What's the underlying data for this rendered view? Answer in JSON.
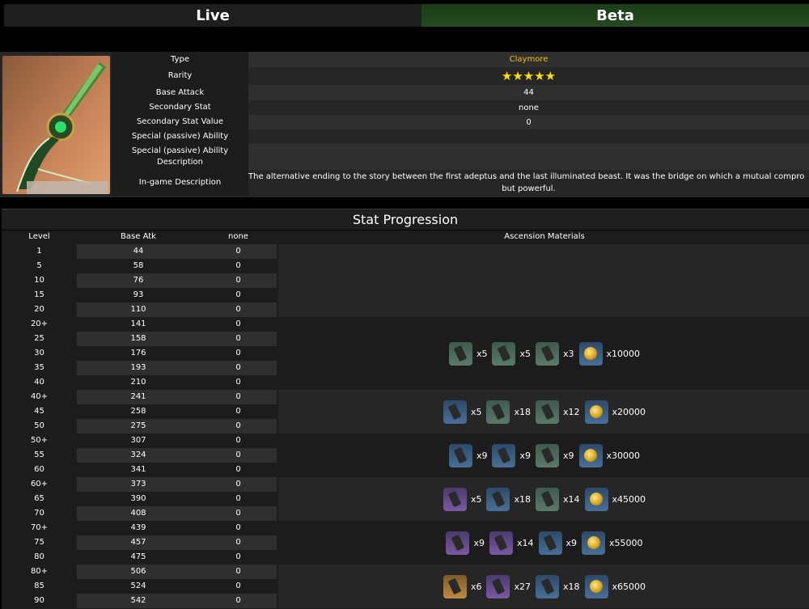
{
  "tabs": {
    "live": "Live",
    "beta": "Beta"
  },
  "info": {
    "type": {
      "label": "Type",
      "value": "Claymore"
    },
    "rarity": {
      "label": "Rarity",
      "stars": "★★★★★"
    },
    "base_attack": {
      "label": "Base Attack",
      "value": "44"
    },
    "secondary_stat": {
      "label": "Secondary Stat",
      "value": "none"
    },
    "secondary_stat_value": {
      "label": "Secondary Stat Value",
      "value": "0"
    },
    "special_ability": {
      "label": "Special (passive) Ability",
      "value": ""
    },
    "special_ability_desc": {
      "label": "Special (passive) Ability Description",
      "value": ""
    },
    "ingame_desc": {
      "label": "In-game Description",
      "line1": "The alternative ending to the story between the first adeptus and the last illuminated beast. It was the bridge on which a mutual compro",
      "line2": "but powerful."
    }
  },
  "stat": {
    "title": "Stat Progression",
    "headers": {
      "level": "Level",
      "base_atk": "Base Atk",
      "secondary": "none",
      "materials": "Ascension Materials"
    },
    "rows": [
      [
        "1",
        "44",
        "0"
      ],
      [
        "5",
        "58",
        "0"
      ],
      [
        "10",
        "76",
        "0"
      ],
      [
        "15",
        "93",
        "0"
      ],
      [
        "20",
        "110",
        "0"
      ],
      [
        "20+",
        "141",
        "0"
      ],
      [
        "25",
        "158",
        "0"
      ],
      [
        "30",
        "176",
        "0"
      ],
      [
        "35",
        "193",
        "0"
      ],
      [
        "40",
        "210",
        "0"
      ],
      [
        "40+",
        "241",
        "0"
      ],
      [
        "45",
        "258",
        "0"
      ],
      [
        "50",
        "275",
        "0"
      ],
      [
        "50+",
        "307",
        "0"
      ],
      [
        "55",
        "324",
        "0"
      ],
      [
        "60",
        "341",
        "0"
      ],
      [
        "60+",
        "373",
        "0"
      ],
      [
        "65",
        "390",
        "0"
      ],
      [
        "70",
        "408",
        "0"
      ],
      [
        "70+",
        "439",
        "0"
      ],
      [
        "75",
        "457",
        "0"
      ],
      [
        "80",
        "475",
        "0"
      ],
      [
        "80+",
        "506",
        "0"
      ],
      [
        "85",
        "524",
        "0"
      ],
      [
        "90",
        "542",
        "0"
      ]
    ],
    "ascensions": [
      {
        "items": [
          {
            "icon": "r2",
            "count": "x5"
          },
          {
            "icon": "r2",
            "count": "x5"
          },
          {
            "icon": "r2",
            "count": "x3"
          },
          {
            "icon": "coin",
            "count": "x10000"
          }
        ]
      },
      {
        "items": [
          {
            "icon": "r3",
            "count": "x5"
          },
          {
            "icon": "r2",
            "count": "x18"
          },
          {
            "icon": "r2",
            "count": "x12"
          },
          {
            "icon": "coin",
            "count": "x20000"
          }
        ]
      },
      {
        "items": [
          {
            "icon": "r3",
            "count": "x9"
          },
          {
            "icon": "r3",
            "count": "x9"
          },
          {
            "icon": "r2",
            "count": "x9"
          },
          {
            "icon": "coin",
            "count": "x30000"
          }
        ]
      },
      {
        "items": [
          {
            "icon": "r4",
            "count": "x5"
          },
          {
            "icon": "r3",
            "count": "x18"
          },
          {
            "icon": "r2",
            "count": "x14"
          },
          {
            "icon": "coin",
            "count": "x45000"
          }
        ]
      },
      {
        "items": [
          {
            "icon": "r4",
            "count": "x9"
          },
          {
            "icon": "r4",
            "count": "x14"
          },
          {
            "icon": "r3",
            "count": "x9"
          },
          {
            "icon": "coin",
            "count": "x55000"
          }
        ]
      },
      {
        "items": [
          {
            "icon": "r5",
            "count": "x6"
          },
          {
            "icon": "r4",
            "count": "x27"
          },
          {
            "icon": "r3",
            "count": "x18"
          },
          {
            "icon": "coin",
            "count": "x65000"
          }
        ]
      }
    ]
  }
}
